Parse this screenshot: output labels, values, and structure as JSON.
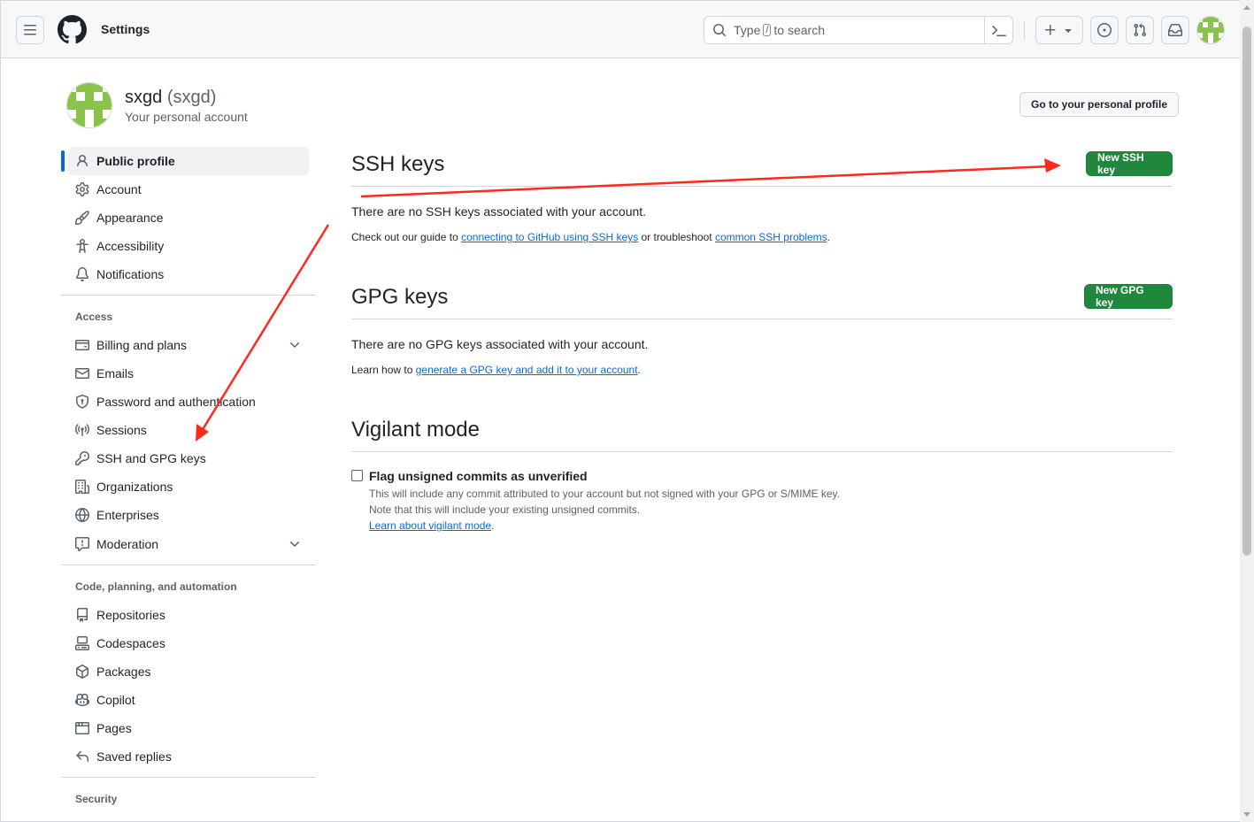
{
  "header": {
    "title": "Settings",
    "search": {
      "prefix": "Type",
      "key": "/",
      "suffix": "to search"
    },
    "icons": [
      "hamburger-icon",
      "github-logo-icon",
      "search-icon",
      "command-palette-icon",
      "plus-icon",
      "issues-icon",
      "pull-requests-icon",
      "inbox-icon"
    ]
  },
  "user": {
    "name": "sxgd",
    "login": "(sxgd)",
    "subtitle": "Your personal account",
    "profile_button": "Go to your personal profile"
  },
  "sidebar": {
    "top_items": [
      {
        "label": "Public profile",
        "icon": "person-icon",
        "active": true
      },
      {
        "label": "Account",
        "icon": "gear-icon"
      },
      {
        "label": "Appearance",
        "icon": "paintbrush-icon"
      },
      {
        "label": "Accessibility",
        "icon": "accessibility-icon"
      },
      {
        "label": "Notifications",
        "icon": "bell-icon"
      }
    ],
    "access": {
      "title": "Access",
      "items": [
        {
          "label": "Billing and plans",
          "icon": "credit-card-icon",
          "expandable": true
        },
        {
          "label": "Emails",
          "icon": "mail-icon"
        },
        {
          "label": "Password and authentication",
          "icon": "shield-lock-icon"
        },
        {
          "label": "Sessions",
          "icon": "broadcast-icon"
        },
        {
          "label": "SSH and GPG keys",
          "icon": "key-icon"
        },
        {
          "label": "Organizations",
          "icon": "organization-icon"
        },
        {
          "label": "Enterprises",
          "icon": "globe-icon"
        },
        {
          "label": "Moderation",
          "icon": "report-icon",
          "expandable": true
        }
      ]
    },
    "code": {
      "title": "Code, planning, and automation",
      "items": [
        {
          "label": "Repositories",
          "icon": "repo-icon"
        },
        {
          "label": "Codespaces",
          "icon": "codespaces-icon"
        },
        {
          "label": "Packages",
          "icon": "package-icon"
        },
        {
          "label": "Copilot",
          "icon": "copilot-icon"
        },
        {
          "label": "Pages",
          "icon": "browser-icon"
        },
        {
          "label": "Saved replies",
          "icon": "reply-icon"
        }
      ]
    },
    "security": {
      "title": "Security"
    }
  },
  "main": {
    "ssh": {
      "title": "SSH keys",
      "button": "New SSH key",
      "empty": "There are no SSH keys associated with your account.",
      "guide_prefix": "Check out our guide to",
      "guide_link1": "connecting to GitHub using SSH keys",
      "guide_mid": "or troubleshoot",
      "guide_link2": "common SSH problems",
      "guide_end": "."
    },
    "gpg": {
      "title": "GPG keys",
      "button": "New GPG key",
      "empty": "There are no GPG keys associated with your account.",
      "learn_prefix": "Learn how to",
      "learn_link": "generate a GPG key and add it to your account",
      "learn_end": "."
    },
    "vigilant": {
      "title": "Vigilant mode",
      "checkbox_label": "Flag unsigned commits as unverified",
      "checked": false,
      "note1": "This will include any commit attributed to your account but not signed with your GPG or S/MIME key.",
      "note2": "Note that this will include your existing unsigned commits.",
      "note_link": "Learn about vigilant mode",
      "note_end": "."
    }
  },
  "colors": {
    "primary_button": "#1f883d",
    "link": "#0969da",
    "active_indicator": "#0969da",
    "annotation_arrow": "#ff2a1a",
    "avatar_green": "#8bc34a"
  }
}
